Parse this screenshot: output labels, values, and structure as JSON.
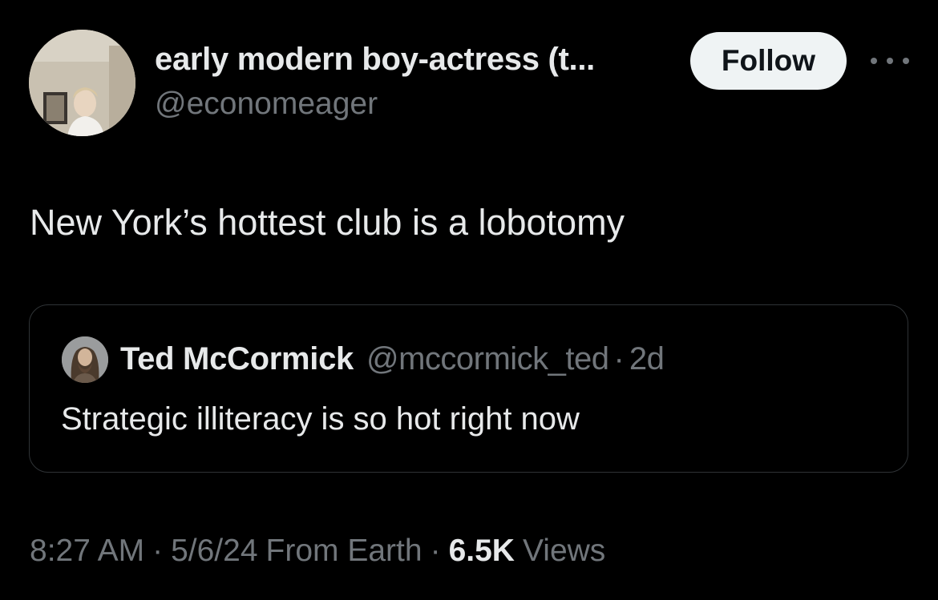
{
  "author": {
    "display_name": "early modern boy-actress (t...",
    "handle": "@economeager"
  },
  "follow_label": "Follow",
  "more_icon": "more-horizontal-icon",
  "tweet": {
    "text": "New York’s hottest club is a lobotomy"
  },
  "quoted_tweet": {
    "display_name": "Ted McCormick",
    "handle": "@mccormick_ted",
    "separator": "·",
    "time_ago": "2d",
    "text": "Strategic illiteracy is so hot right now"
  },
  "meta": {
    "time": "8:27 AM",
    "separator": "·",
    "date": "5/6/24",
    "location": "From Earth",
    "views_count": "6.5K",
    "views_label": "Views"
  },
  "colors": {
    "background": "#000000",
    "primary_text": "#e7e9ea",
    "secondary_text": "#71767b",
    "border": "#2f3336",
    "follow_bg": "#eff3f4"
  }
}
